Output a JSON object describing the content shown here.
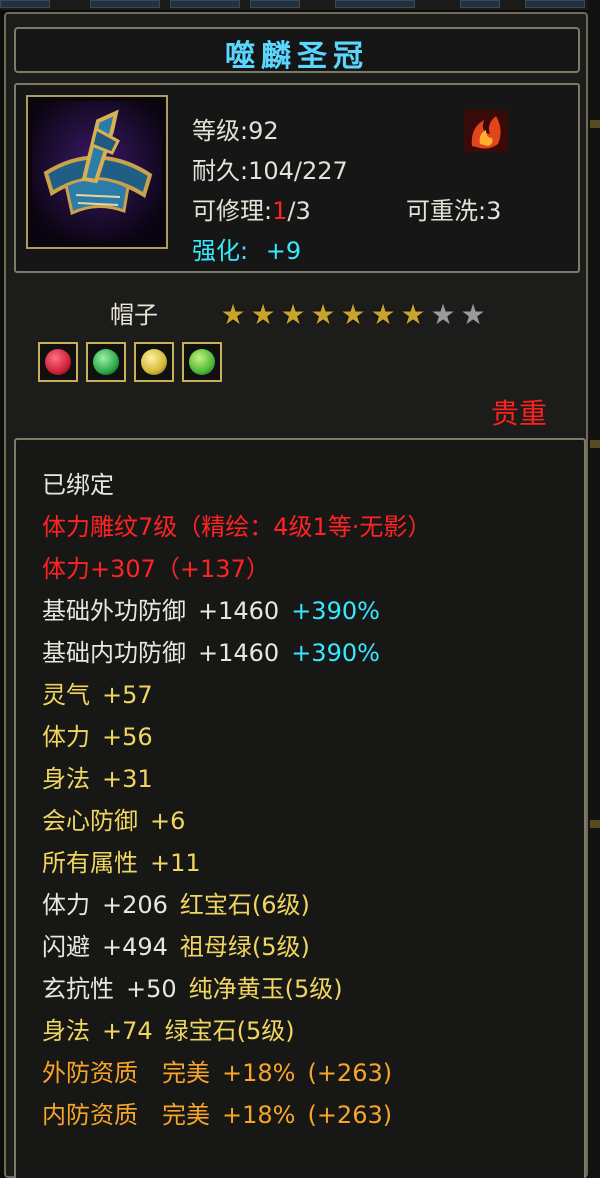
{
  "item": {
    "name": "噬麟圣冠",
    "level_label": "等级",
    "level": "92",
    "durability_label": "耐久",
    "durability": "104/227",
    "repair_label": "可修理",
    "repair_used": "1",
    "repair_total": "/3",
    "rewash_label": "可重洗",
    "rewash": "3",
    "enhance_label": "强化:",
    "enhance": "+9",
    "type": "帽子",
    "stars_filled": 7,
    "stars_total": 9,
    "quality": "贵重"
  },
  "gems": [
    {
      "icon": "ruby-gem-icon",
      "color": "#d0203a"
    },
    {
      "icon": "emerald-gem-icon",
      "color": "#2ea84a"
    },
    {
      "icon": "yellow-jade-gem-icon",
      "color": "#d4b83a"
    },
    {
      "icon": "green-gem-icon",
      "color": "#4fb83a"
    }
  ],
  "attributes": {
    "bound": "已绑定",
    "carving": "体力雕纹7级（精绘：4级1等·无影）",
    "carving_stat": "体力+307（+137）",
    "base_ext_def": {
      "label": "基础外功防御",
      "value": "+1460",
      "pct": "+390%"
    },
    "base_int_def": {
      "label": "基础内功防御",
      "value": "+1460",
      "pct": "+390%"
    },
    "bonuses": [
      {
        "label": "灵气",
        "value": "+57"
      },
      {
        "label": "体力",
        "value": "+56"
      },
      {
        "label": "身法",
        "value": "+31"
      },
      {
        "label": "会心防御",
        "value": "+6"
      },
      {
        "label": "所有属性",
        "value": "+11"
      }
    ],
    "gem_stats": [
      {
        "label": "体力",
        "value": "+206",
        "gem": "红宝石(6级)"
      },
      {
        "label": "闪避",
        "value": "+494",
        "gem": "祖母绿(5级)"
      },
      {
        "label": "玄抗性",
        "value": "+50",
        "gem": "纯净黄玉(5级)"
      },
      {
        "label": "身法",
        "value": "+74",
        "gem": "绿宝石(5级)"
      }
    ],
    "aptitudes": [
      {
        "label": "外防资质",
        "grade": "完美",
        "pct": "+18%",
        "extra": "(+263)"
      },
      {
        "label": "内防资质",
        "grade": "完美",
        "pct": "+18%",
        "extra": "(+263)"
      }
    ]
  },
  "colors": {
    "title": "#5ad6ff",
    "red": "#ff2323",
    "yellow": "#f0d660",
    "orange": "#f7a528",
    "cyan": "#38e8ff"
  }
}
